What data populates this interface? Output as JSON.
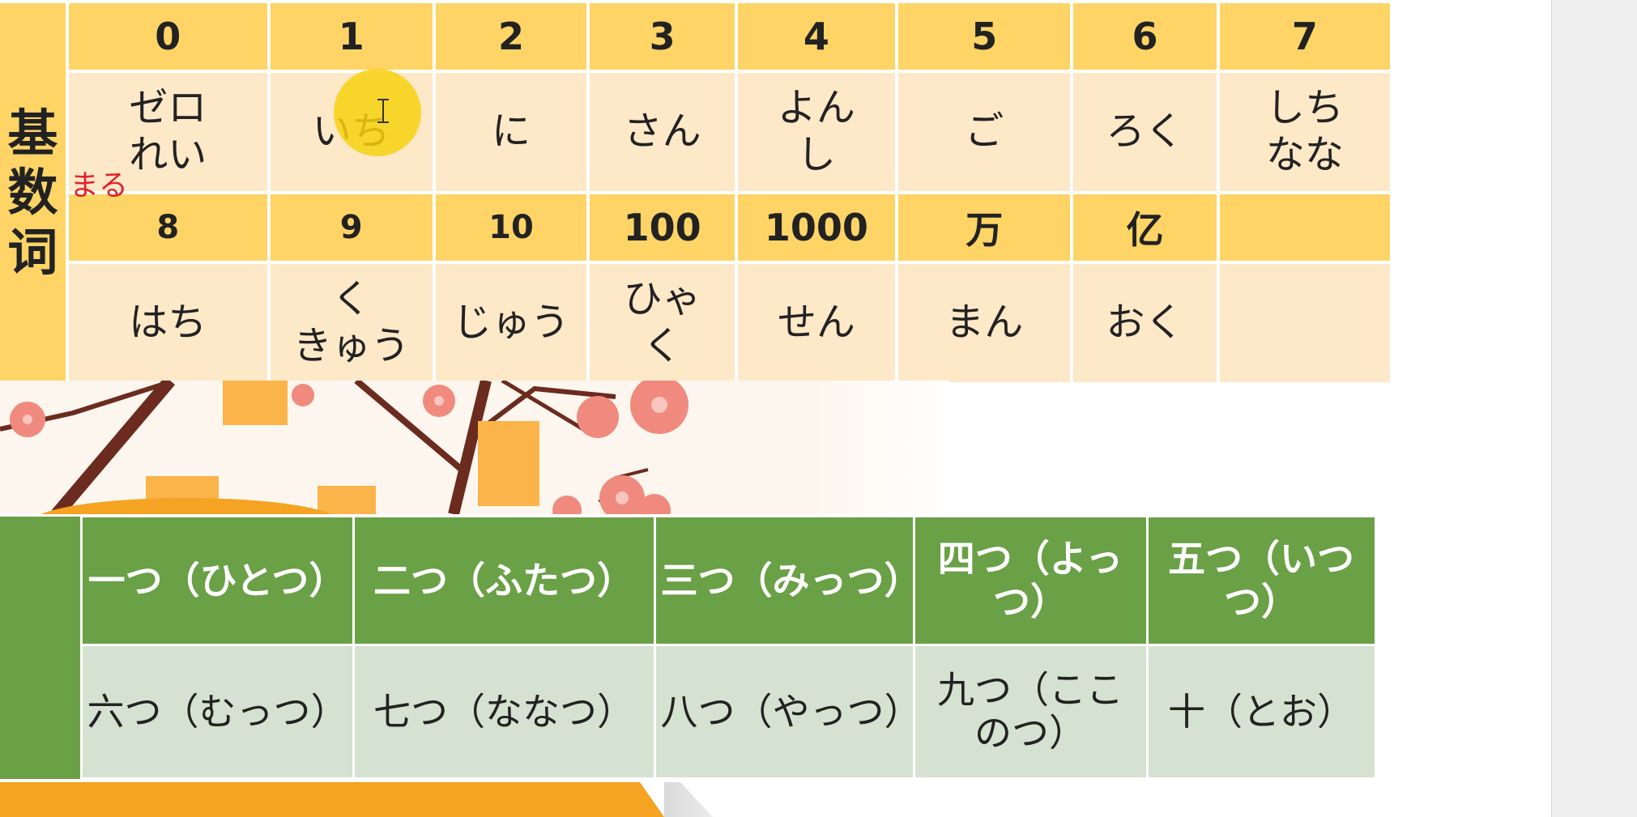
{
  "cardinal": {
    "side_label": [
      "基",
      "数",
      "词"
    ],
    "note_maru": "まる",
    "row1_headers": [
      "0",
      "1",
      "2",
      "3",
      "4",
      "5",
      "6",
      "7"
    ],
    "row1_readings": [
      [
        "ゼロ",
        "れい"
      ],
      [
        "いち"
      ],
      [
        "に"
      ],
      [
        "さん"
      ],
      [
        "よん",
        "し"
      ],
      [
        "ご"
      ],
      [
        "ろく"
      ],
      [
        "しち",
        "なな"
      ]
    ],
    "row2_headers": [
      "8",
      "9",
      "10",
      "100",
      "1000",
      "万",
      "亿",
      ""
    ],
    "row2_readings": [
      [
        "はち"
      ],
      [
        "く",
        "きゅう"
      ],
      [
        "じゅう"
      ],
      [
        "ひゃ",
        "く"
      ],
      [
        "せん"
      ],
      [
        "まん"
      ],
      [
        "おく"
      ],
      [
        ""
      ]
    ]
  },
  "counters": {
    "header_row": [
      "一つ（ひとつ）",
      "二つ（ふたつ）",
      "三つ（みっつ）",
      "四つ（よっつ）",
      "五つ（いつつ）"
    ],
    "body_row": [
      "六つ（むっつ）",
      "七つ（ななつ）",
      "八つ（やっつ）",
      "九つ（ここのつ）",
      "十（とお）"
    ]
  },
  "colors": {
    "yellow_header": "#fed466",
    "cream_cell": "#fde8c8",
    "green_header": "#6aa046",
    "green_cell": "#d5e2d1",
    "annotation_red": "#e0222a",
    "blossom": "#f08a7e",
    "branch": "#6b2b1e"
  }
}
